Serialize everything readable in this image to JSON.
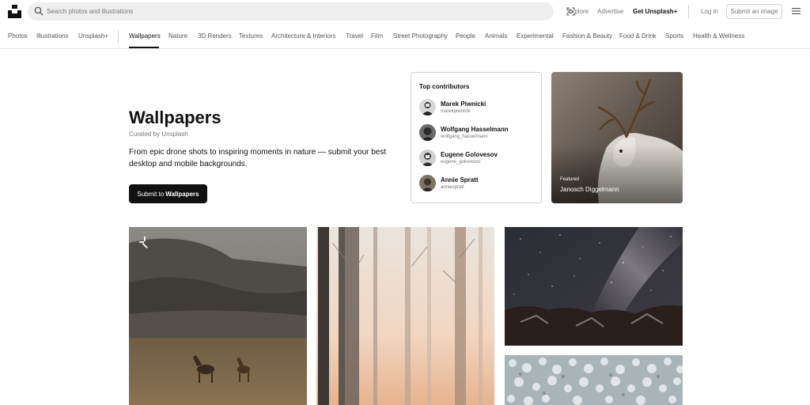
{
  "header": {
    "search_placeholder": "Search photos and illustrations",
    "links": {
      "explore": "Explore",
      "advertise": "Advertise",
      "get_plus": "Get Unsplash+",
      "login": "Log in"
    },
    "submit_image": "Submit an image"
  },
  "categories": [
    "Photos",
    "Illustrations",
    "Unsplash+",
    "Wallpapers",
    "Nature",
    "3D Renders",
    "Textures",
    "Architecture & Interiors",
    "Travel",
    "Film",
    "Street Photography",
    "People",
    "Animals",
    "Experimental",
    "Fashion & Beauty",
    "Food & Drink",
    "Sports",
    "Health & Wellness"
  ],
  "active_category": "Wallpapers",
  "hero": {
    "title": "Wallpapers",
    "curated": "Curated by Unsplash",
    "description": "From epic drone shots to inspiring moments in nature — submit your best desktop and mobile backgrounds.",
    "submit_prefix": "Submit to",
    "submit_topic": "Wallpapers"
  },
  "contributors": {
    "title": "Top contributors",
    "list": [
      {
        "name": "Marek Piwnicki",
        "username": "marekpiwnicki"
      },
      {
        "name": "Wolfgang Hasselmann",
        "username": "wolfgang_hasselmann"
      },
      {
        "name": "Eugene Golovesov",
        "username": "eugene_golovesov"
      },
      {
        "name": "Annie Spratt",
        "username": "anniespratt"
      }
    ]
  },
  "featured": {
    "label": "Featured",
    "name": "Janosch Diggelmann"
  },
  "colors": {
    "accent": "#111111",
    "muted": "#767676",
    "border": "#d1d1d1"
  }
}
